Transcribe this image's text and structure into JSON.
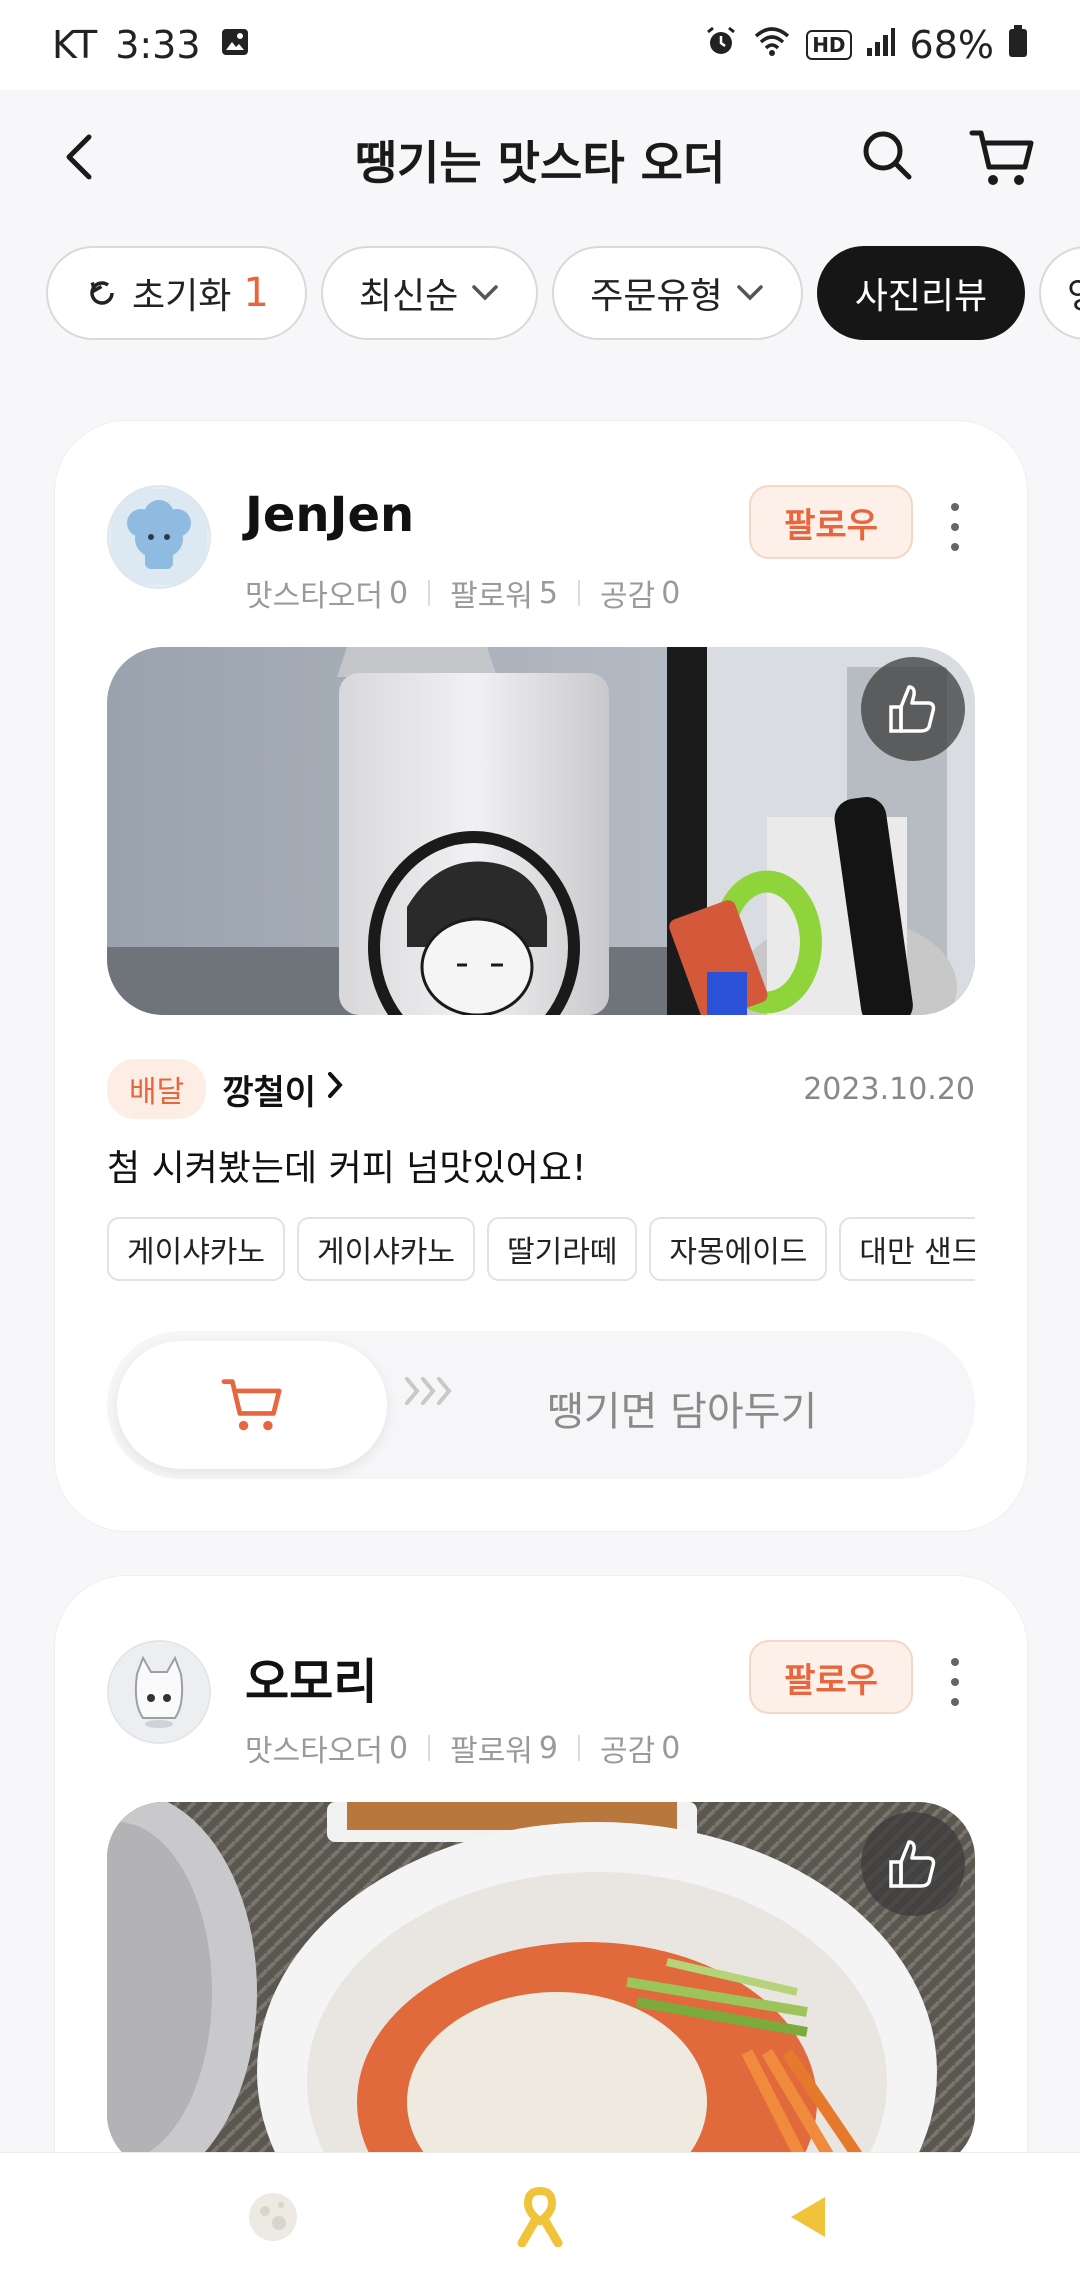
{
  "status_bar": {
    "carrier": "KT",
    "time": "3:33",
    "battery": "68%",
    "network_badge": "HD",
    "icons": [
      "gallery-icon",
      "alarm-icon",
      "wifi-icon",
      "hd-voice-icon",
      "signal-icon",
      "battery-icon"
    ]
  },
  "header": {
    "title": "땡기는 맛스타 오더",
    "icons": [
      "back-icon",
      "search-icon",
      "cart-icon"
    ]
  },
  "filters": [
    {
      "label": "초기화",
      "count": "1",
      "icon": "refresh-icon"
    },
    {
      "label": "최신순",
      "icon": "chevron-down-icon"
    },
    {
      "label": "주문유형",
      "icon": "chevron-down-icon"
    },
    {
      "label": "사진리뷰",
      "active": true
    },
    {
      "label": "영"
    }
  ],
  "reviews": [
    {
      "username": "JenJen",
      "stats": {
        "orders_label": "맛스타오더",
        "orders": "0",
        "followers_label": "팔로워",
        "followers": "5",
        "likes_label": "공감",
        "likes": "0"
      },
      "follow_label": "팔로우",
      "order_type": "배달",
      "store": "깡철이",
      "date": "2023.10.20",
      "text": "첨 시켜봤는데 커피 넘맛있어요!",
      "tags": [
        "게이샤카노",
        "게이샤카노",
        "딸기라떼",
        "자몽에이드",
        "대만 샌드위"
      ],
      "cart_cta": "땡기면 담아두기"
    },
    {
      "username": "오모리",
      "stats": {
        "orders_label": "맛스타오더",
        "orders": "0",
        "followers_label": "팔로워",
        "followers": "9",
        "likes_label": "공감",
        "likes": "0"
      },
      "follow_label": "팔로우"
    }
  ],
  "bottom_nav": {
    "icons": [
      "moon-icon",
      "ribbon-icon",
      "back-triangle-icon"
    ]
  },
  "colors": {
    "accent": "#e8663d",
    "active_chip": "#161616",
    "ribbon": "#f0c33a"
  }
}
